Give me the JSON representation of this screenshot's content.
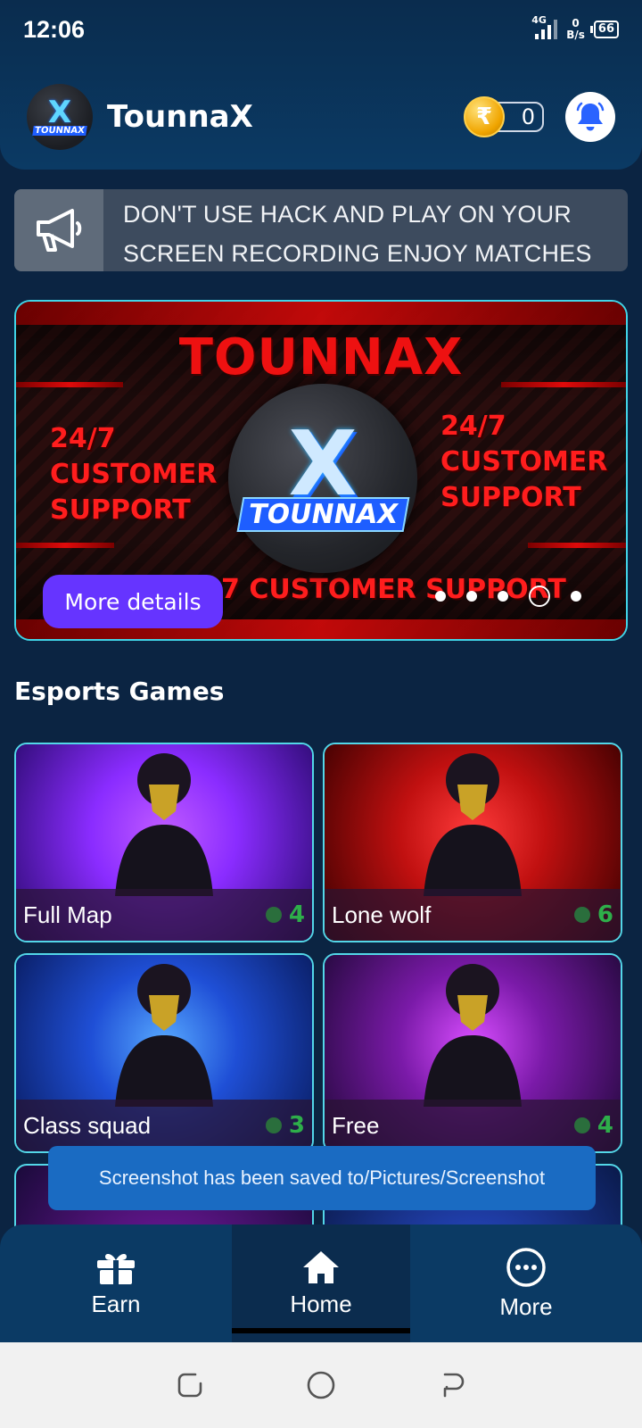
{
  "status_bar": {
    "time": "12:06",
    "network": "4G",
    "speed_value": "0",
    "speed_unit": "B/s",
    "battery": "66"
  },
  "app": {
    "title": "TounnaX",
    "logo_text": "TOUNNAX",
    "logo_letter": "X",
    "coins": "0",
    "coin_symbol": "₹"
  },
  "notice": {
    "text": "DON'T USE HACK AND PLAY ON YOUR SCREEN RECORDING ENJOY MATCHES"
  },
  "banner": {
    "title": "TOUNNAX",
    "left_text": [
      "24/7",
      "CUSTOMER",
      "SUPPORT"
    ],
    "right_text": [
      "24/7",
      "CUSTOMER",
      "SUPPORT"
    ],
    "bottom_text": "7 CUSTOMER SUPPORT",
    "logo_letter": "X",
    "logo_text": "TOUNNAX",
    "cta": "More details",
    "slides": 5,
    "active_slide": 4
  },
  "section": {
    "title": "Esports Games"
  },
  "games": [
    {
      "name": "Full Map",
      "count": "4",
      "palette": [
        "#2a0a6e",
        "#8a2cff",
        "#c05bff"
      ]
    },
    {
      "name": "Lone wolf",
      "count": "6",
      "palette": [
        "#3a0000",
        "#c01010",
        "#ff3b3b"
      ]
    },
    {
      "name": "Class squad",
      "count": "3",
      "palette": [
        "#081a5c",
        "#1f4fd6",
        "#56a8ff"
      ]
    },
    {
      "name": "Free",
      "count": "4",
      "palette": [
        "#200838",
        "#7a1aa8",
        "#d84dff"
      ]
    }
  ],
  "toast": {
    "text": "Screenshot has been saved to/Pictures/Screenshot"
  },
  "bottom_nav": {
    "earn": "Earn",
    "home": "Home",
    "more": "More"
  },
  "colors": {
    "accent": "#6634ff",
    "card_border": "#53d7e8",
    "online": "#2eae4a",
    "header": "#0b3a64"
  }
}
